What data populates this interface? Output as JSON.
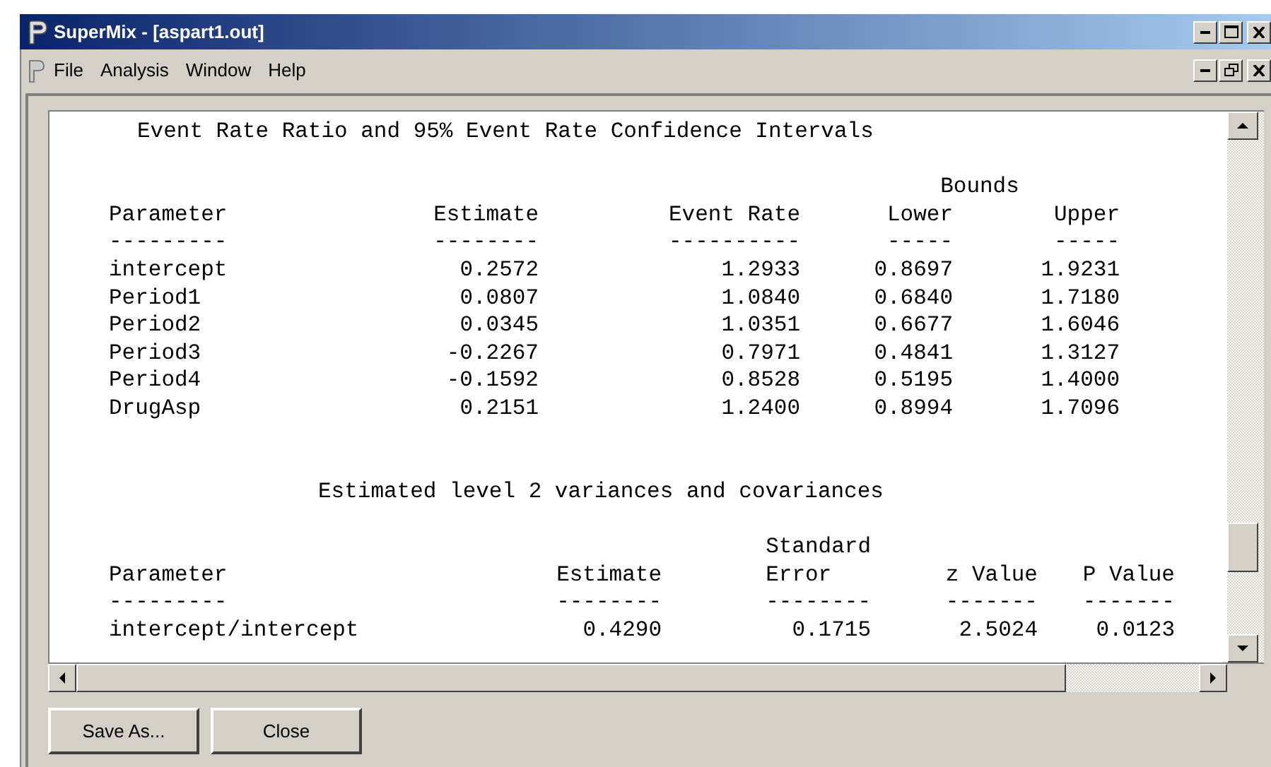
{
  "window": {
    "title": "SuperMix - [aspart1.out]"
  },
  "menu": [
    "File",
    "Analysis",
    "Window",
    "Help"
  ],
  "output": {
    "title_1": "Event Rate Ratio and 95% Event Rate Confidence Intervals",
    "table_1": {
      "group_header": "Bounds",
      "columns": [
        "Parameter",
        "Estimate",
        "Event Rate",
        "Lower",
        "Upper"
      ],
      "dashes": [
        "---------",
        "--------",
        "----------",
        "-----",
        "-----"
      ],
      "rows": [
        [
          "intercept",
          "0.2572",
          "1.2933",
          "0.8697",
          "1.9231"
        ],
        [
          "Period1",
          "0.0807",
          "1.0840",
          "0.6840",
          "1.7180"
        ],
        [
          "Period2",
          "0.0345",
          "1.0351",
          "0.6677",
          "1.6046"
        ],
        [
          "Period3",
          "-0.2267",
          "0.7971",
          "0.4841",
          "1.3127"
        ],
        [
          "Period4",
          "-0.1592",
          "0.8528",
          "0.5195",
          "1.4000"
        ],
        [
          "DrugAsp",
          "0.2151",
          "1.2400",
          "0.8994",
          "1.7096"
        ]
      ]
    },
    "title_2": "Estimated level 2 variances and covariances",
    "table_2": {
      "group_header": "Standard",
      "columns": [
        "Parameter",
        "Estimate",
        "Error",
        "z Value",
        "P Value"
      ],
      "dashes": [
        "---------",
        "--------",
        "--------",
        "-------",
        "-------"
      ],
      "rows": [
        [
          "intercept/intercept",
          "0.4290",
          "0.1715",
          "2.5024",
          "0.0123"
        ]
      ]
    }
  },
  "buttons": [
    "Save As...",
    "Close"
  ]
}
